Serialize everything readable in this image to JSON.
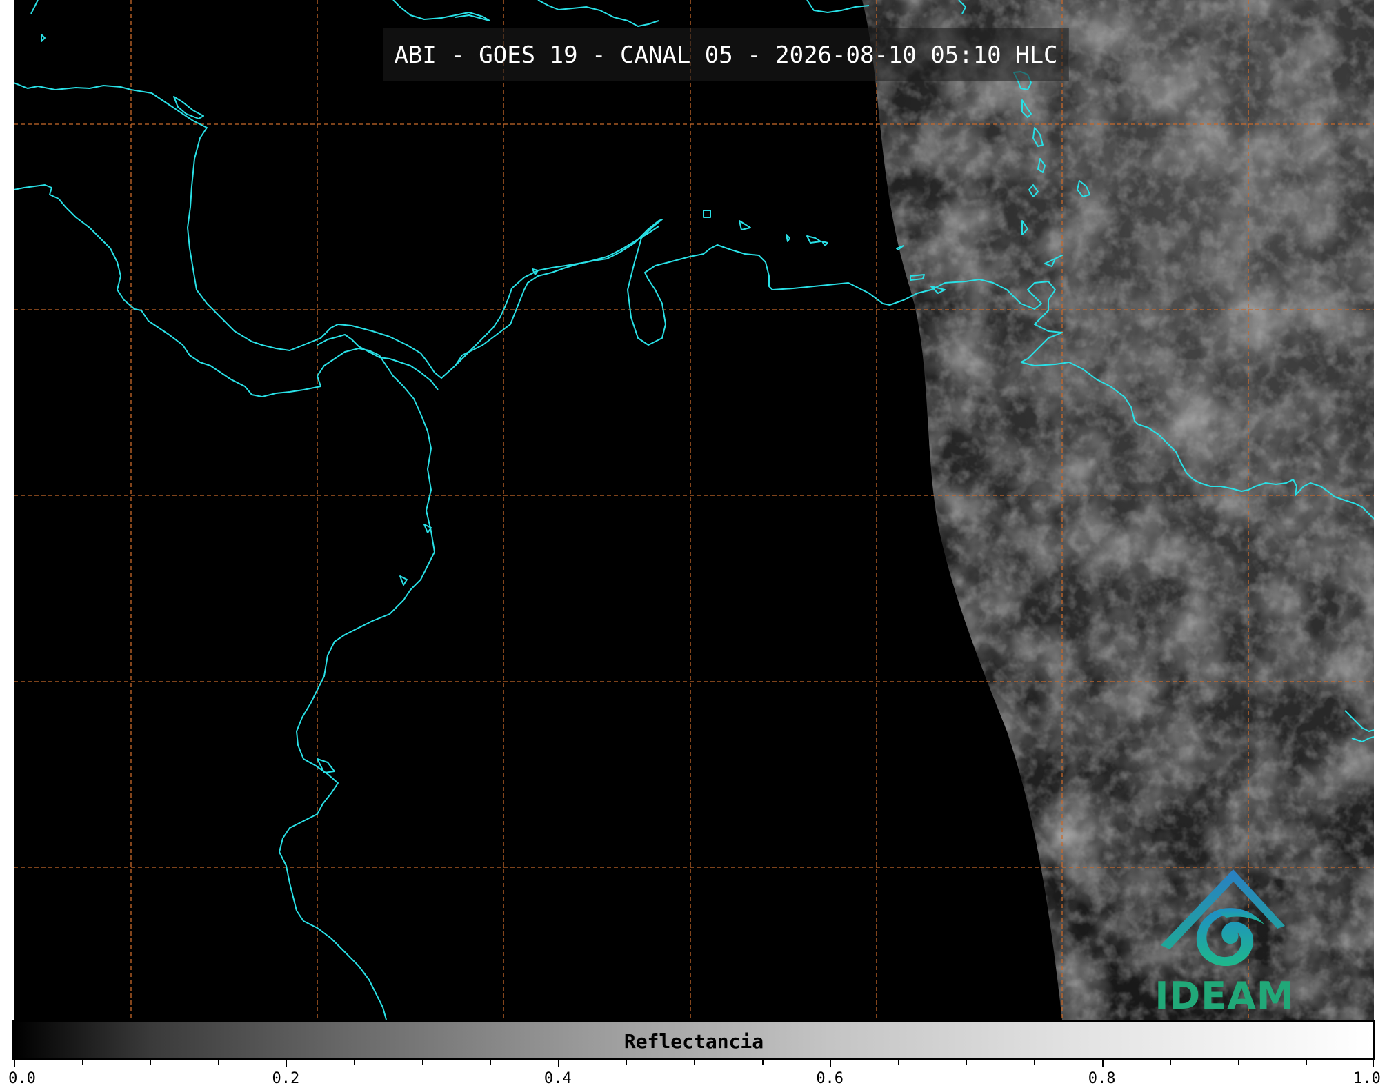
{
  "title": "ABI - GOES 19 - CANAL 05 - 2026-08-10 05:10 HLC",
  "colorbar": {
    "label": "Reflectancia",
    "min": 0.0,
    "max": 1.0,
    "ticks": [
      "0.0",
      "0.2",
      "0.4",
      "0.6",
      "0.8",
      "1.0"
    ],
    "minor_step": 0.05,
    "colormap": "grayscale"
  },
  "logo": {
    "text": "IDEAM",
    "mountain_color": "#2a7fc4",
    "swirl_color": "#1fa897",
    "text_color": "#21a878"
  },
  "map": {
    "background_color": "#000000",
    "coastline_color": "#29e0e6",
    "gridline_color": "#c8692a",
    "gridline_style": "dashed"
  }
}
